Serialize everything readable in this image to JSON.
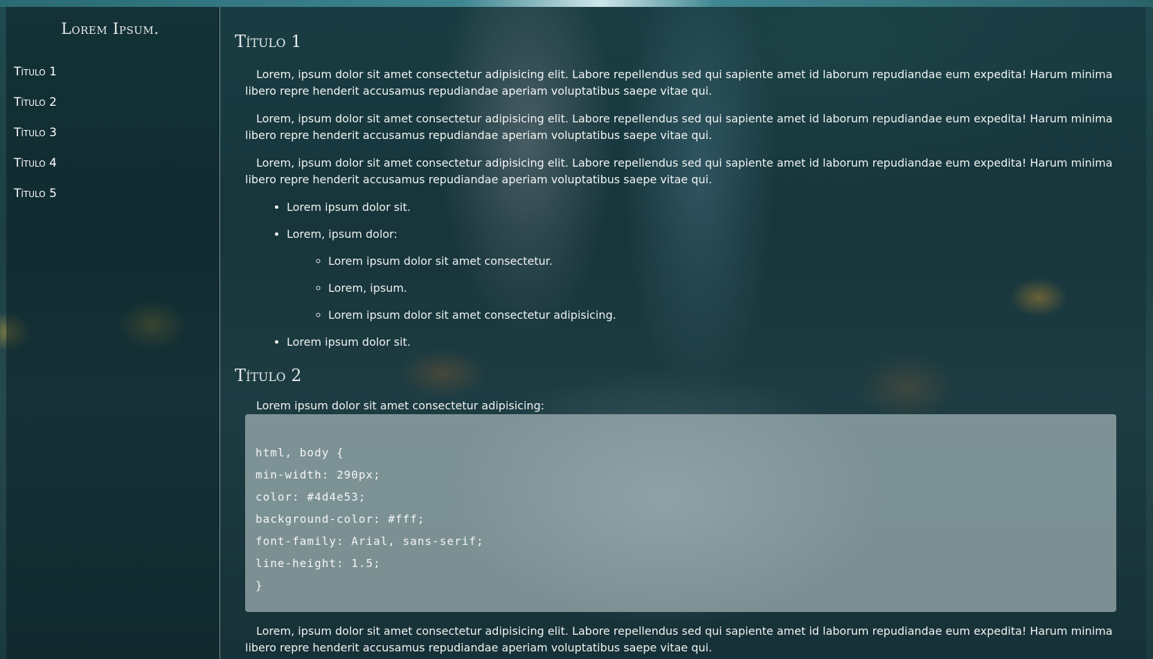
{
  "sidebar": {
    "brand": "Lorem Ipsum.",
    "items": [
      {
        "label": "Título 1"
      },
      {
        "label": "Título 2"
      },
      {
        "label": "Título 3"
      },
      {
        "label": "Título 4"
      },
      {
        "label": "Título 5"
      }
    ]
  },
  "main": {
    "sections": [
      {
        "title": "Título 1",
        "paragraphs": [
          "Lorem, ipsum dolor sit amet consectetur adipisicing elit. Labore repellendus sed qui sapiente amet id laborum repudiandae eum expedita! Harum minima libero repre henderit accusamus repudiandae aperiam voluptatibus saepe vitae qui.",
          "Lorem, ipsum dolor sit amet consectetur adipisicing elit. Labore repellendus sed qui sapiente amet id laborum repudiandae eum expedita! Harum minima libero repre henderit accusamus repudiandae aperiam voluptatibus saepe vitae qui.",
          "Lorem, ipsum dolor sit amet consectetur adipisicing elit. Labore repellendus sed qui sapiente amet id laborum repudiandae eum expedita! Harum minima libero repre henderit accusamus repudiandae aperiam voluptatibus saepe vitae qui."
        ],
        "list": [
          "Lorem ipsum dolor sit.",
          "Lorem, ipsum dolor:",
          "Lorem ipsum dolor sit."
        ],
        "sublist": [
          "Lorem ipsum dolor sit amet consectetur.",
          "Lorem, ipsum.",
          "Lorem ipsum dolor sit amet consectetur adipisicing."
        ]
      },
      {
        "title": "Título 2",
        "intro": "Lorem ipsum dolor sit amet consectetur adipisicing:",
        "code": [
          "html, body {",
          "min-width: 290px;",
          "color: #4d4e53;",
          "background-color: #fff;",
          "font-family: Arial, sans-serif;",
          "line-height: 1.5;",
          "}"
        ],
        "paragraph": "Lorem, ipsum dolor sit amet consectetur adipisicing elit. Labore repellendus sed qui sapiente amet id laborum repudiandae eum expedita! Harum minima libero repre henderit accusamus repudiandae aperiam voluptatibus saepe vitae qui."
      }
    ]
  }
}
